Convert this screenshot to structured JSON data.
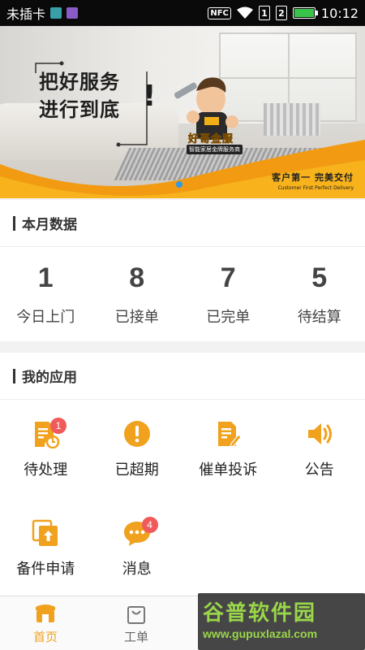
{
  "status_bar": {
    "carrier": "未插卡",
    "nfc": "NFC",
    "sim1": "1",
    "sim2": "2",
    "time": "10:12"
  },
  "banner": {
    "slogan_line1": "把好服务",
    "slogan_line2": "进行到底",
    "brand": "好哥金服",
    "brand_sub": "智能家居金牌服务商",
    "tagline_cn": "客户第一  完美交付",
    "tagline_en": "Customer First   Perfect Delivery"
  },
  "monthly": {
    "title": "本月数据",
    "stats": [
      {
        "value": "1",
        "label": "今日上门"
      },
      {
        "value": "8",
        "label": "已接单"
      },
      {
        "value": "7",
        "label": "已完单"
      },
      {
        "value": "5",
        "label": "待结算"
      }
    ]
  },
  "apps": {
    "title": "我的应用",
    "items": [
      {
        "label": "待处理",
        "icon": "pending-doc-clock-icon",
        "badge": "1"
      },
      {
        "label": "已超期",
        "icon": "exclamation-circle-icon"
      },
      {
        "label": "催单投诉",
        "icon": "doc-edit-icon"
      },
      {
        "label": "公告",
        "icon": "speaker-icon"
      },
      {
        "label": "备件申请",
        "icon": "upload-copy-icon"
      },
      {
        "label": "消息",
        "icon": "chat-bubble-icon",
        "badge": "4"
      }
    ]
  },
  "bottom_nav": {
    "items": [
      {
        "label": "首页",
        "icon": "store-icon",
        "active": true
      },
      {
        "label": "工单",
        "icon": "shopping-bag-icon",
        "active": false
      }
    ]
  },
  "watermark": {
    "title": "谷普软件园",
    "url": "www.gupuxlazal.com"
  },
  "colors": {
    "accent": "#f0a21e",
    "badge": "#f05a5a",
    "indicator_dot": "#2a9be8"
  }
}
